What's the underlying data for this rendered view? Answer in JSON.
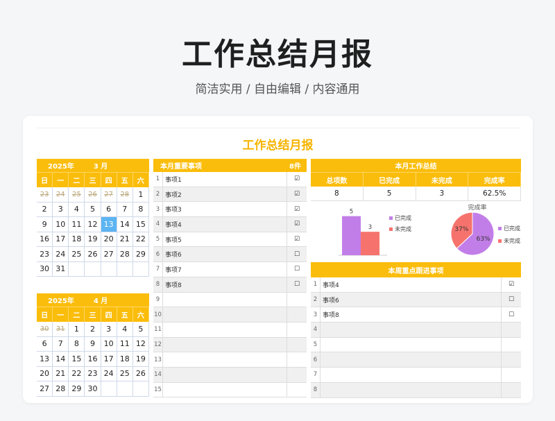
{
  "hero": {
    "title": "工作总结月报",
    "subtitle": "简洁实用 / 自由编辑 / 内容通用"
  },
  "sheet_title": "工作总结月报",
  "weekdays": [
    "日",
    "一",
    "二",
    "三",
    "四",
    "五",
    "六"
  ],
  "calendars": [
    {
      "year": "2025年",
      "month": "3 月",
      "days": [
        {
          "d": "23",
          "t": "prev"
        },
        {
          "d": "24",
          "t": "prev"
        },
        {
          "d": "25",
          "t": "prev"
        },
        {
          "d": "26",
          "t": "prev"
        },
        {
          "d": "27",
          "t": "prev"
        },
        {
          "d": "28",
          "t": "prev"
        },
        {
          "d": "1",
          "t": ""
        },
        {
          "d": "2",
          "t": ""
        },
        {
          "d": "3",
          "t": ""
        },
        {
          "d": "4",
          "t": ""
        },
        {
          "d": "5",
          "t": ""
        },
        {
          "d": "6",
          "t": ""
        },
        {
          "d": "7",
          "t": ""
        },
        {
          "d": "8",
          "t": ""
        },
        {
          "d": "9",
          "t": ""
        },
        {
          "d": "10",
          "t": ""
        },
        {
          "d": "11",
          "t": ""
        },
        {
          "d": "12",
          "t": ""
        },
        {
          "d": "13",
          "t": "today"
        },
        {
          "d": "14",
          "t": ""
        },
        {
          "d": "15",
          "t": ""
        },
        {
          "d": "16",
          "t": ""
        },
        {
          "d": "17",
          "t": ""
        },
        {
          "d": "18",
          "t": ""
        },
        {
          "d": "19",
          "t": ""
        },
        {
          "d": "20",
          "t": ""
        },
        {
          "d": "21",
          "t": ""
        },
        {
          "d": "22",
          "t": ""
        },
        {
          "d": "23",
          "t": ""
        },
        {
          "d": "24",
          "t": ""
        },
        {
          "d": "25",
          "t": ""
        },
        {
          "d": "26",
          "t": ""
        },
        {
          "d": "27",
          "t": ""
        },
        {
          "d": "28",
          "t": ""
        },
        {
          "d": "29",
          "t": ""
        },
        {
          "d": "30",
          "t": ""
        },
        {
          "d": "31",
          "t": ""
        },
        {
          "d": "",
          "t": "blank"
        },
        {
          "d": "",
          "t": "blank"
        },
        {
          "d": "",
          "t": "blank"
        },
        {
          "d": "",
          "t": "blank"
        },
        {
          "d": "",
          "t": "blank"
        }
      ]
    },
    {
      "year": "2025年",
      "month": "4 月",
      "days": [
        {
          "d": "30",
          "t": "prev"
        },
        {
          "d": "31",
          "t": "prev"
        },
        {
          "d": "1",
          "t": ""
        },
        {
          "d": "2",
          "t": ""
        },
        {
          "d": "3",
          "t": ""
        },
        {
          "d": "4",
          "t": ""
        },
        {
          "d": "5",
          "t": ""
        },
        {
          "d": "6",
          "t": ""
        },
        {
          "d": "7",
          "t": ""
        },
        {
          "d": "8",
          "t": ""
        },
        {
          "d": "9",
          "t": ""
        },
        {
          "d": "10",
          "t": ""
        },
        {
          "d": "11",
          "t": ""
        },
        {
          "d": "12",
          "t": ""
        },
        {
          "d": "13",
          "t": ""
        },
        {
          "d": "14",
          "t": ""
        },
        {
          "d": "15",
          "t": ""
        },
        {
          "d": "16",
          "t": ""
        },
        {
          "d": "17",
          "t": ""
        },
        {
          "d": "18",
          "t": ""
        },
        {
          "d": "19",
          "t": ""
        },
        {
          "d": "20",
          "t": ""
        },
        {
          "d": "21",
          "t": ""
        },
        {
          "d": "22",
          "t": ""
        },
        {
          "d": "23",
          "t": ""
        },
        {
          "d": "24",
          "t": ""
        },
        {
          "d": "25",
          "t": ""
        },
        {
          "d": "26",
          "t": ""
        },
        {
          "d": "27",
          "t": ""
        },
        {
          "d": "28",
          "t": ""
        },
        {
          "d": "29",
          "t": ""
        },
        {
          "d": "30",
          "t": ""
        },
        {
          "d": "",
          "t": "blank"
        },
        {
          "d": "",
          "t": "blank"
        },
        {
          "d": "",
          "t": "blank"
        }
      ]
    }
  ],
  "tasks": {
    "title": "本月重要事项",
    "count": "8件",
    "rows": [
      {
        "no": "1",
        "name": "事项1",
        "check": "☑"
      },
      {
        "no": "2",
        "name": "事项2",
        "check": "☑"
      },
      {
        "no": "3",
        "name": "事项3",
        "check": "☑"
      },
      {
        "no": "4",
        "name": "事项4",
        "check": "☑"
      },
      {
        "no": "5",
        "name": "事项5",
        "check": "☑"
      },
      {
        "no": "6",
        "name": "事项6",
        "check": "☐"
      },
      {
        "no": "7",
        "name": "事项7",
        "check": "☐"
      },
      {
        "no": "8",
        "name": "事项8",
        "check": "☐"
      },
      {
        "no": "9",
        "name": "",
        "check": ""
      },
      {
        "no": "10",
        "name": "",
        "check": ""
      },
      {
        "no": "11",
        "name": "",
        "check": ""
      },
      {
        "no": "12",
        "name": "",
        "check": ""
      },
      {
        "no": "13",
        "name": "",
        "check": ""
      },
      {
        "no": "14",
        "name": "",
        "check": ""
      },
      {
        "no": "15",
        "name": "",
        "check": ""
      }
    ]
  },
  "summary": {
    "title": "本月工作总结",
    "labels": [
      "总项数",
      "已完成",
      "未完成",
      "完成率"
    ],
    "values": [
      "8",
      "5",
      "3",
      "62.5%"
    ]
  },
  "colors": {
    "accent": "#fbbd0c",
    "done": "#c27ee8",
    "undone": "#f6736d",
    "today": "#5cb4f2"
  },
  "chart_data": [
    {
      "type": "bar",
      "categories": [
        "已完成",
        "未完成"
      ],
      "values": [
        5,
        3
      ],
      "ylim": [
        0,
        5.5
      ],
      "legend": [
        "已完成",
        "未完成"
      ],
      "legend_position": "right"
    },
    {
      "type": "pie",
      "title": "完成率",
      "labels": [
        "已完成",
        "未完成"
      ],
      "values": [
        63,
        37
      ],
      "value_labels": [
        "63%",
        "37%"
      ],
      "legend": [
        "已完成",
        "未完成"
      ],
      "legend_position": "right"
    }
  ],
  "focus": {
    "title": "本周重点跟进事项",
    "rows": [
      {
        "no": "1",
        "name": "事项4",
        "check": "☑"
      },
      {
        "no": "2",
        "name": "事项6",
        "check": "☐"
      },
      {
        "no": "3",
        "name": "事项8",
        "check": "☐"
      },
      {
        "no": "4",
        "name": "",
        "check": ""
      },
      {
        "no": "5",
        "name": "",
        "check": ""
      },
      {
        "no": "6",
        "name": "",
        "check": ""
      },
      {
        "no": "7",
        "name": "",
        "check": ""
      },
      {
        "no": "8",
        "name": "",
        "check": ""
      }
    ]
  }
}
